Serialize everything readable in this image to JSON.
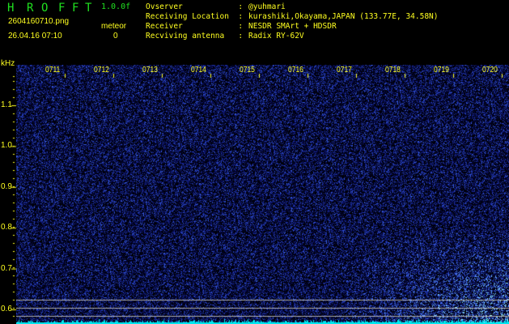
{
  "header": {
    "title_letters": [
      "H",
      "R",
      "O",
      "F",
      "F",
      "T"
    ],
    "version": "1.0.0f",
    "filename": "2604160710.png",
    "datetime": "26.04.16 07:10",
    "meteor_label": "meteor",
    "meteor_count": "0",
    "info": [
      {
        "label": "Ovserver            :",
        "value": "@yuhmari"
      },
      {
        "label": "Receiving Location  :",
        "value": "kurashiki,Okayama,JAPAN (133.77E, 34.58N)"
      },
      {
        "label": "Receiver            :",
        "value": "NESDR SMArt + HDSDR"
      },
      {
        "label": "Recviving antenna   :",
        "value": "Radix RY-62V"
      }
    ]
  },
  "axis": {
    "unit": "kHz",
    "y_labels": [
      "1.1",
      "1.0",
      "0.9",
      "0.8",
      "0.7",
      "0.6"
    ],
    "time_labels": [
      "0711",
      "0712",
      "0713",
      "0714",
      "0715",
      "0716",
      "0717",
      "0718",
      "0719",
      "0720"
    ]
  },
  "colors": {
    "text": "#ffff20",
    "title": "#20e020",
    "noise": "#2030ff",
    "baseline": "#00ffff"
  }
}
